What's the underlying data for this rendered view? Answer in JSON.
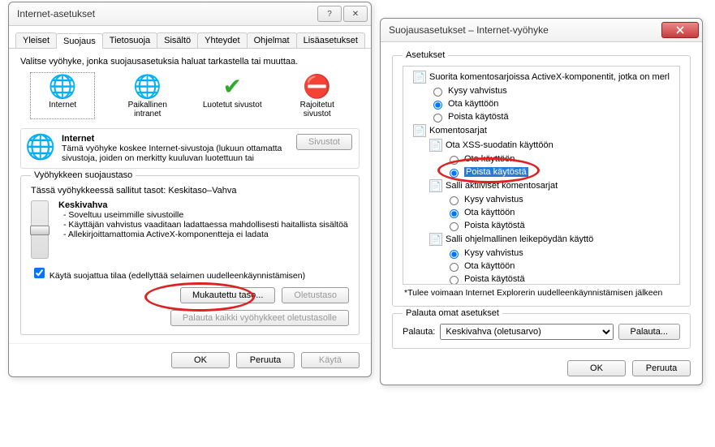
{
  "dialog1": {
    "title": "Internet-asetukset",
    "help": "?",
    "close": "✕",
    "tabs": [
      "Yleiset",
      "Suojaus",
      "Tietosuoja",
      "Sisältö",
      "Yhteydet",
      "Ohjelmat",
      "Lisäasetukset"
    ],
    "active_tab": 1,
    "zone_intro": "Valitse vyöhyke, jonka suojausasetuksia haluat tarkastella tai muuttaa.",
    "zones": [
      {
        "label": "Internet",
        "icon": "🌐"
      },
      {
        "label": "Paikallinen intranet",
        "icon": "🌐"
      },
      {
        "label": "Luotetut sivustot",
        "icon": "✔"
      },
      {
        "label": "Rajoitetut sivustot",
        "icon": "⛔"
      }
    ],
    "info_title": "Internet",
    "info_desc": "Tämä vyöhyke koskee Internet-sivustoja (lukuun ottamatta sivustoja, joiden on merkitty kuuluvan luotettuun tai",
    "sites_btn": "Sivustot",
    "group_title": "Vyöhykkeen suojaustaso",
    "allowed": "Tässä vyöhykkeessä sallitut tasot: Keskitaso–Vahva",
    "level": "Keskivahva",
    "bullets": [
      "- Soveltuu useimmille sivustoille",
      "- Käyttäjän vahvistus vaaditaan ladattaessa mahdollisesti haitallista sisältöä",
      "- Allekirjoittamattomia ActiveX-komponentteja ei ladata"
    ],
    "protected_mode": "Käytä suojattua tilaa (edellyttää selaimen uudelleenkäynnistämisen)",
    "custom_level": "Mukautettu taso...",
    "default_level": "Oletustaso",
    "reset_all": "Palauta kaikki vyöhykkeet oletustasolle",
    "ok": "OK",
    "cancel": "Peruuta",
    "apply": "Käytä"
  },
  "dialog2": {
    "title": "Suojausasetukset – Internet-vyöhyke",
    "close": "✕",
    "group_title": "Asetukset",
    "tree": [
      {
        "level": 1,
        "icon": "script",
        "text": "Suorita komentosarjoissa ActiveX-komponentit, jotka on merl"
      },
      {
        "level": 2,
        "radio": false,
        "text": "Kysy vahvistus"
      },
      {
        "level": 2,
        "radio": true,
        "text": "Ota käyttöön"
      },
      {
        "level": 2,
        "radio": false,
        "text": "Poista käytöstä"
      },
      {
        "level": 1,
        "icon": "script-root",
        "text": "Komentosarjat"
      },
      {
        "level": 2,
        "icon": "script",
        "text": "Ota XSS-suodatin käyttöön"
      },
      {
        "level": 3,
        "radio": false,
        "text": "Ota käyttöön"
      },
      {
        "level": 3,
        "radio": true,
        "selected": true,
        "text": "Poista käytöstä"
      },
      {
        "level": 2,
        "icon": "script",
        "text": "Salli aktiiviset komentosarjat"
      },
      {
        "level": 3,
        "radio": false,
        "text": "Kysy vahvistus"
      },
      {
        "level": 3,
        "radio": true,
        "text": "Ota käyttöön"
      },
      {
        "level": 3,
        "radio": false,
        "text": "Poista käytöstä"
      },
      {
        "level": 2,
        "icon": "script",
        "text": "Salli ohjelmallinen leikepöydän käyttö"
      },
      {
        "level": 3,
        "radio": true,
        "text": "Kysy vahvistus"
      },
      {
        "level": 3,
        "radio": false,
        "text": "Ota käyttöön"
      },
      {
        "level": 3,
        "radio": false,
        "text": "Poista käytöstä"
      }
    ],
    "footnote": "*Tulee voimaan Internet Explorerin uudelleenkäynnistämisen jälkeen",
    "reset_group": "Palauta omat asetukset",
    "reset_label": "Palauta:",
    "reset_value": "Keskivahva (oletusarvo)",
    "reset_btn": "Palauta...",
    "ok": "OK",
    "cancel": "Peruuta"
  }
}
